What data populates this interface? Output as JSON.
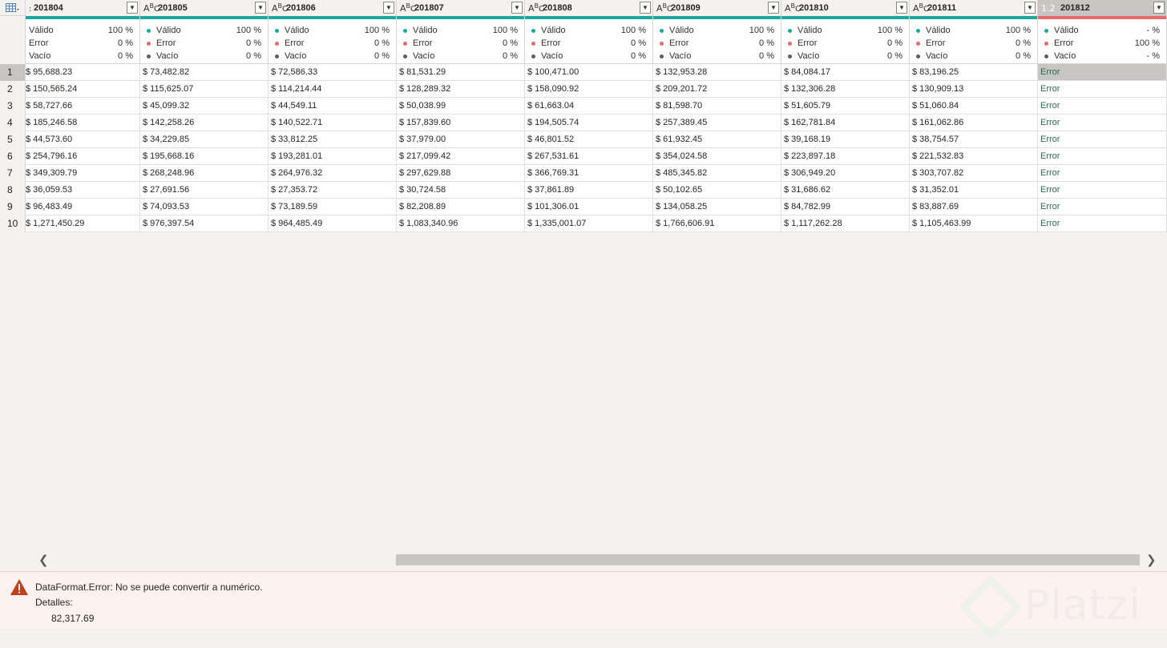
{
  "columns": [
    {
      "name": "201804",
      "type": "ABC"
    },
    {
      "name": "201805",
      "type": "ABC"
    },
    {
      "name": "201806",
      "type": "ABC"
    },
    {
      "name": "201807",
      "type": "ABC"
    },
    {
      "name": "201808",
      "type": "ABC"
    },
    {
      "name": "201809",
      "type": "ABC"
    },
    {
      "name": "201810",
      "type": "ABC"
    },
    {
      "name": "201811",
      "type": "ABC"
    },
    {
      "name": "201812",
      "type": "1.2"
    }
  ],
  "quality_labels": {
    "valid": "Válido",
    "error": "Error",
    "empty": "Vacío"
  },
  "quality": [
    {
      "valid": "100 %",
      "error": "0 %",
      "empty": "0 %"
    },
    {
      "valid": "100 %",
      "error": "0 %",
      "empty": "0 %"
    },
    {
      "valid": "100 %",
      "error": "0 %",
      "empty": "0 %"
    },
    {
      "valid": "100 %",
      "error": "0 %",
      "empty": "0 %"
    },
    {
      "valid": "100 %",
      "error": "0 %",
      "empty": "0 %"
    },
    {
      "valid": "100 %",
      "error": "0 %",
      "empty": "0 %"
    },
    {
      "valid": "100 %",
      "error": "0 %",
      "empty": "0 %"
    },
    {
      "valid": "100 %",
      "error": "0 %",
      "empty": "0 %"
    },
    {
      "valid": "- %",
      "error": "100 %",
      "empty": "- %"
    }
  ],
  "rows": [
    [
      "$ 95,688.23",
      "$ 73,482.82",
      "$ 72,586.33",
      "$ 81,531.29",
      "$ 100,471.00",
      "$ 132,953.28",
      "$ 84,084.17",
      "$ 83,196.25",
      "Error"
    ],
    [
      "$ 150,565.24",
      "$ 115,625.07",
      "$ 114,214.44",
      "$ 128,289.32",
      "$ 158,090.92",
      "$ 209,201.72",
      "$ 132,306.28",
      "$ 130,909.13",
      "Error"
    ],
    [
      "$ 58,727.66",
      "$ 45,099.32",
      "$ 44,549.11",
      "$ 50,038.99",
      "$ 61,663.04",
      "$ 81,598.70",
      "$ 51,605.79",
      "$ 51,060.84",
      "Error"
    ],
    [
      "$ 185,246.58",
      "$ 142,258.26",
      "$ 140,522.71",
      "$ 157,839.60",
      "$ 194,505.74",
      "$ 257,389.45",
      "$ 162,781.84",
      "$ 161,062.86",
      "Error"
    ],
    [
      "$ 44,573.60",
      "$ 34,229.85",
      "$ 33,812.25",
      "$ 37,979.00",
      "$ 46,801.52",
      "$ 61,932.45",
      "$ 39,168.19",
      "$ 38,754.57",
      "Error"
    ],
    [
      "$ 254,796.16",
      "$ 195,668.16",
      "$ 193,281.01",
      "$ 217,099.42",
      "$ 267,531.61",
      "$ 354,024.58",
      "$ 223,897.18",
      "$ 221,532.83",
      "Error"
    ],
    [
      "$ 349,309.79",
      "$ 268,248.96",
      "$ 264,976.32",
      "$ 297,629.88",
      "$ 366,769.31",
      "$ 485,345.82",
      "$ 306,949.20",
      "$ 303,707.82",
      "Error"
    ],
    [
      "$ 36,059.53",
      "$ 27,691.56",
      "$ 27,353.72",
      "$ 30,724.58",
      "$ 37,861.89",
      "$ 50,102.65",
      "$ 31,686.62",
      "$ 31,352.01",
      "Error"
    ],
    [
      "$ 96,483.49",
      "$ 74,093.53",
      "$ 73,189.59",
      "$ 82,208.89",
      "$ 101,306.01",
      "$ 134,058.25",
      "$ 84,782.99",
      "$ 83,887.69",
      "Error"
    ],
    [
      "$ 1,271,450.29",
      "$ 976,397.54",
      "$ 964,485.49",
      "$ 1,083,340.96",
      "$ 1,335,001.07",
      "$ 1,766,606.91",
      "$ 1,117,262.28",
      "$ 1,105,463.99",
      "Error"
    ]
  ],
  "colors": {
    "valid": "#1aa89d",
    "error": "#e66c6c",
    "empty": "#605e5c"
  },
  "error_panel": {
    "message": "DataFormat.Error: No se puede convertir a numérico.",
    "details_label": "Detalles:",
    "details_value": "82,317.69"
  },
  "watermark": "Platzi"
}
